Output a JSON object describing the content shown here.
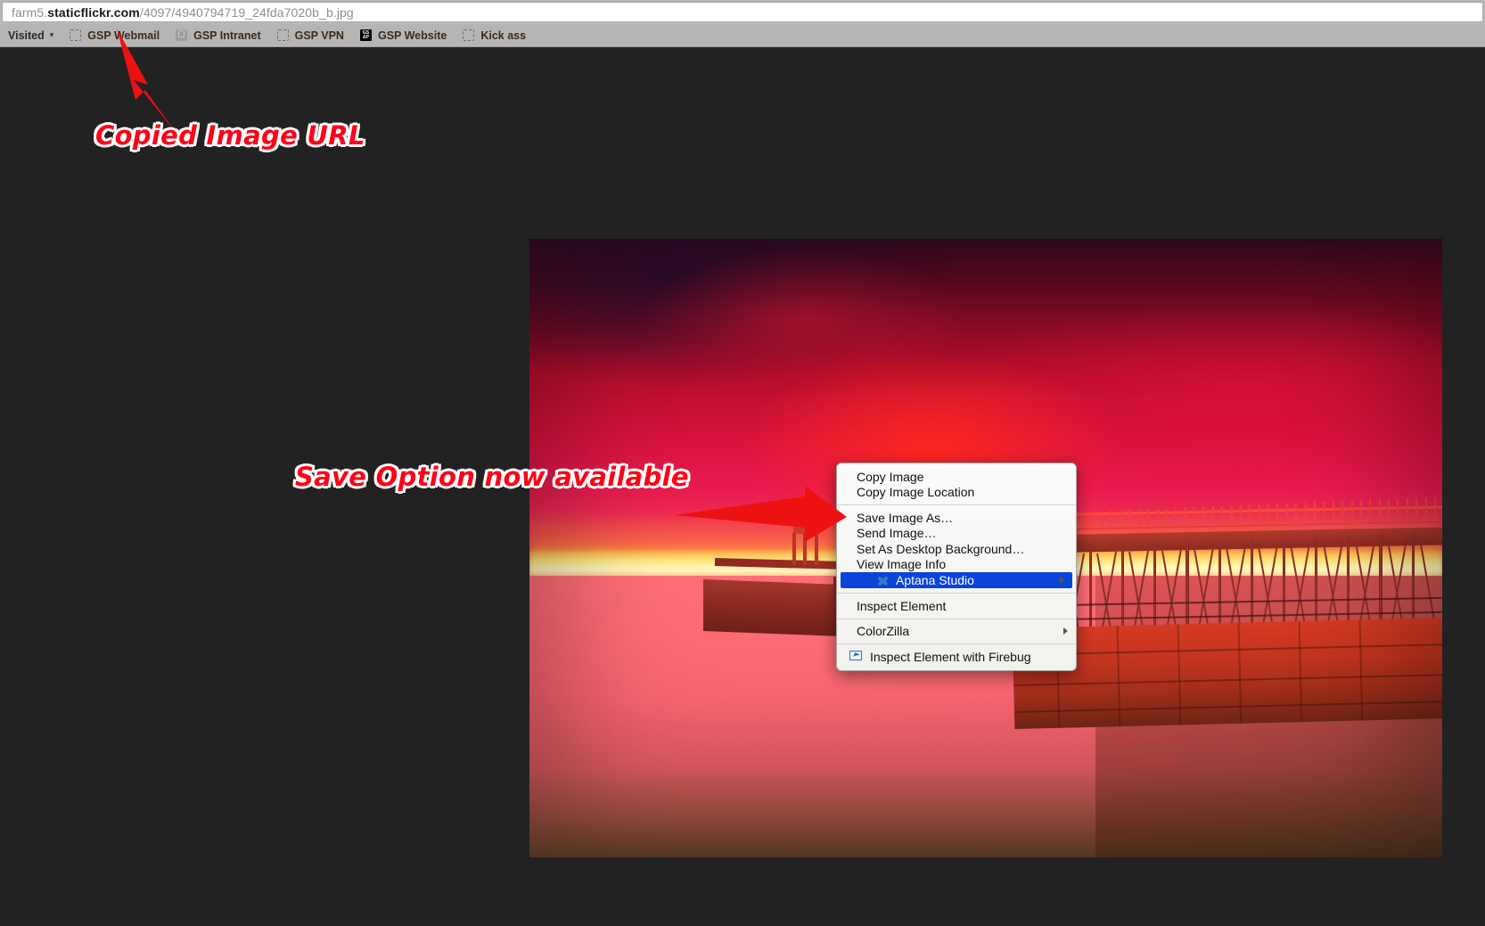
{
  "browser": {
    "url": {
      "prefix": "farm5.",
      "domain": "staticflickr.com",
      "path": "/4097/4940794719_24fda7020b_b.jpg",
      "full": "farm5.staticflickr.com/4097/4940794719_24fda7020b_b.jpg"
    },
    "bookmarks": [
      {
        "label": "Visited",
        "icon": "none",
        "caret": "▾"
      },
      {
        "label": "GSP Webmail",
        "icon": "dashed-placeholder-icon"
      },
      {
        "label": "GSP Intranet",
        "icon": "apple-icon"
      },
      {
        "label": "GSP VPN",
        "icon": "dashed-placeholder-icon"
      },
      {
        "label": "GSP Website",
        "icon": "gsp-favicon",
        "favicon_line1": "GS",
        "favicon_line2": "&P"
      },
      {
        "label": "Kick ass",
        "icon": "dashed-placeholder-icon"
      }
    ]
  },
  "context_menu": {
    "groups": [
      {
        "items": [
          {
            "label": "Copy Image",
            "type": "item"
          },
          {
            "label": "Copy Image Location",
            "type": "item"
          }
        ]
      },
      {
        "items": [
          {
            "label": "Save Image As…",
            "type": "item"
          },
          {
            "label": "Send Image…",
            "type": "item"
          },
          {
            "label": "Set As Desktop Background…",
            "type": "item"
          },
          {
            "label": "View Image Info",
            "type": "item"
          },
          {
            "label": "Aptana Studio",
            "type": "submenu",
            "icon": "aptana-icon",
            "highlighted": true,
            "submenu_arrow": "▶"
          }
        ]
      },
      {
        "items": [
          {
            "label": "Inspect Element",
            "type": "item"
          }
        ]
      },
      {
        "items": [
          {
            "label": "ColorZilla",
            "type": "submenu",
            "submenu_arrow": "▶"
          }
        ]
      },
      {
        "items": [
          {
            "label": "Inspect Element with Firebug",
            "type": "item",
            "icon": "firebug-icon"
          }
        ]
      }
    ],
    "highlight_color": "#0b44d8"
  },
  "annotations": [
    {
      "id": "anno1",
      "text": "Copied Image URL",
      "color": "#ff0018",
      "outline": "#ffffff",
      "points_to": "url-bar"
    },
    {
      "id": "anno2",
      "text": "Save Option now available",
      "color": "#ff0018",
      "outline": "#ffffff",
      "points_to": "save-image-as-menu-item"
    }
  ],
  "photo": {
    "alt": "Sunset over a pier with lighthouse, red and magenta sky reflected on the sea",
    "background_color": "#222222"
  }
}
